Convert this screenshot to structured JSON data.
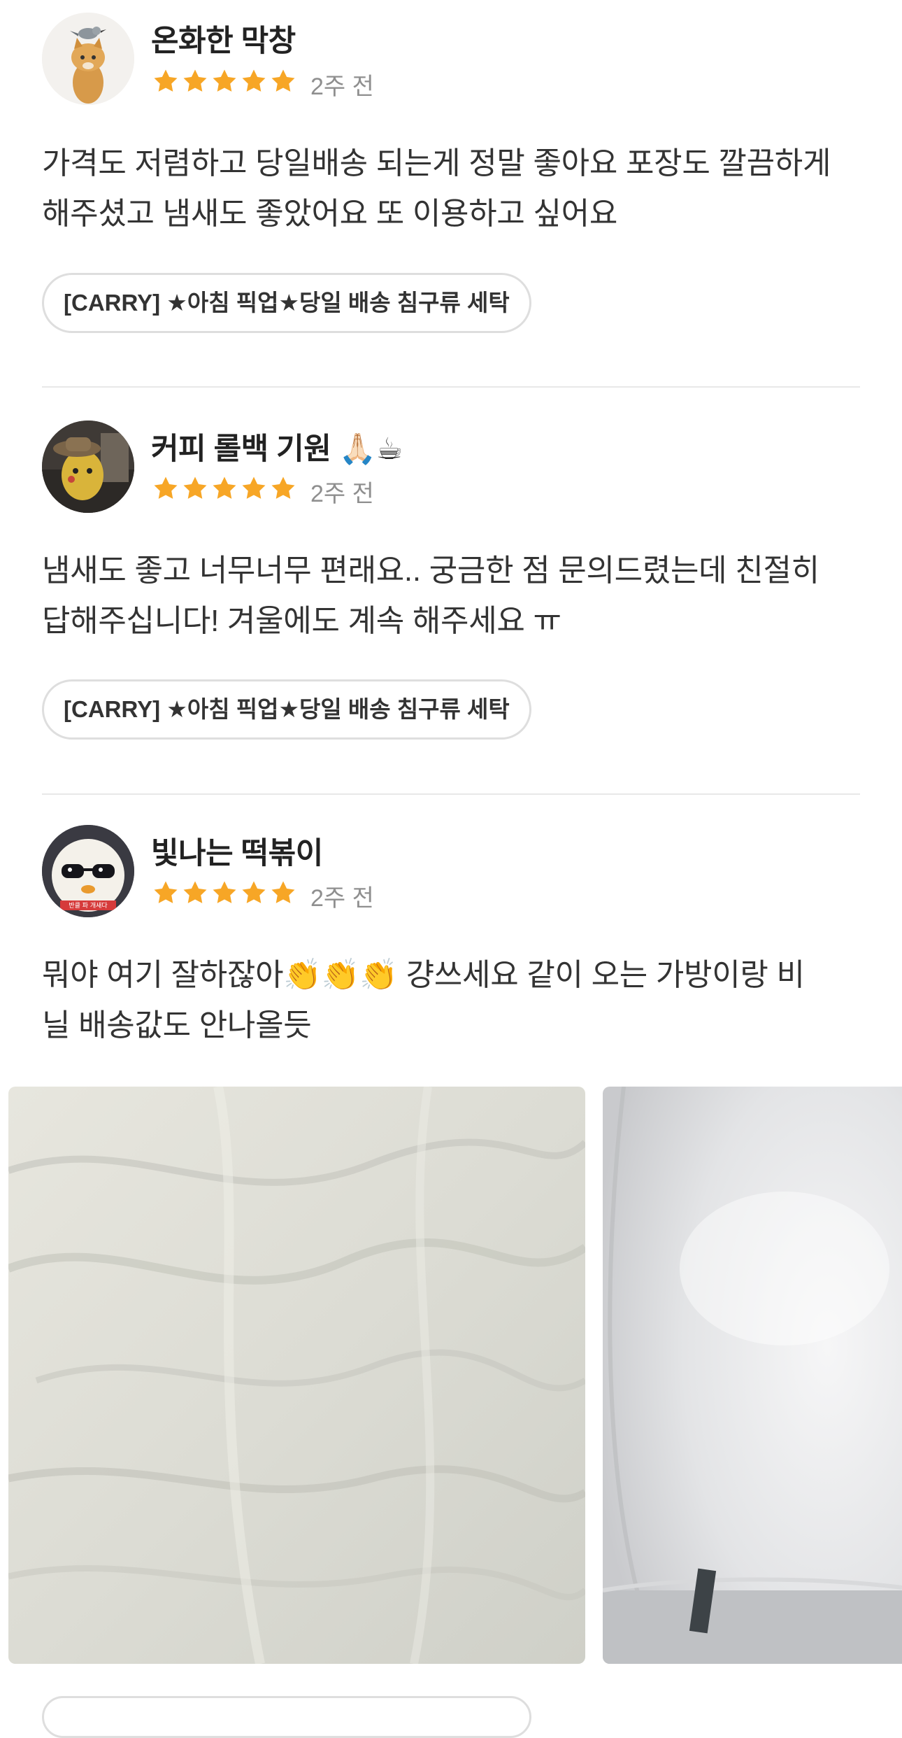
{
  "reviews": [
    {
      "name": "온화한 막창",
      "rating": 5,
      "time": "2주 전",
      "text_lines": [
        "가격도 저렴하고 당일배송 되는게 정말 좋아요 포장도 깔끔하게",
        "해주셨고 냄새도 좋았어요 또 이용하고 싶어요"
      ],
      "product_tag": "[CARRY] ★아침 픽업★당일 배송 침구류 세탁",
      "avatar_icon": "cat-with-bird-avatar"
    },
    {
      "name": "커피 롤백 기원 🙏🏻☕",
      "rating": 5,
      "time": "2주 전",
      "text_lines": [
        "냄새도 좋고 너무너무 편래요.. 궁금한 점 문의드렸는데 친절히",
        "답해주십니다! 겨울에도 계속 해주세요 ㅠ"
      ],
      "product_tag": "[CARRY] ★아침 픽업★당일 배송 침구류 세탁",
      "avatar_icon": "detective-pikachu-avatar"
    },
    {
      "name": "빛나는 떡볶이",
      "rating": 5,
      "time": "2주 전",
      "text_lines": [
        "뭐야 여기 잘하잖아👏👏👏 걍쓰세요 같이 오는 가방이랑 비",
        "닐 배송값도 안나올듯"
      ],
      "avatar_icon": "sunglasses-chick-avatar",
      "avatar_caption": "반클 파 개새다"
    }
  ],
  "photos": [
    {
      "name": "wrinkled-white-bedding-photo"
    },
    {
      "name": "bubble-wrap-roll-photo"
    }
  ],
  "colors": {
    "star": "#F7A626",
    "time": "#8f8f8f",
    "divider": "#e8e8e8",
    "tag_border": "#dedede"
  }
}
